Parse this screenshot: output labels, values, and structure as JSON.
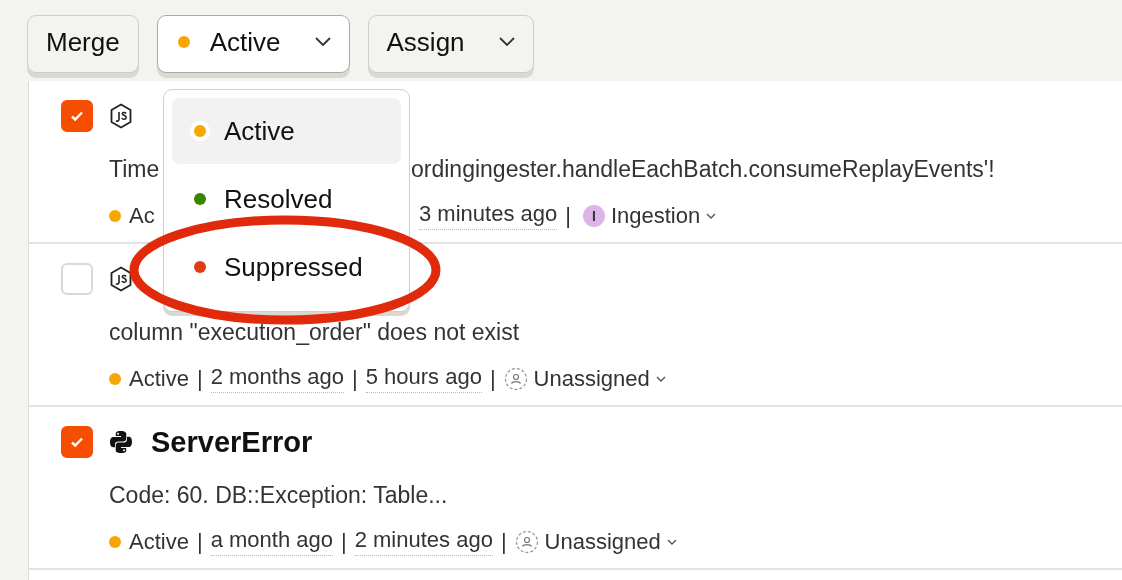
{
  "toolbar": {
    "buttons": [
      {
        "kind": "plain",
        "label": "Merge",
        "open": false
      },
      {
        "kind": "status",
        "label": "Active",
        "color": "#f7a501",
        "open": true
      },
      {
        "kind": "menu",
        "label": "Assign",
        "open": false
      }
    ]
  },
  "status_menu": {
    "options": [
      {
        "label": "Active",
        "color": "#f7a501",
        "selected": true,
        "circled": false
      },
      {
        "label": "Resolved",
        "color": "#388600",
        "selected": false,
        "circled": false
      },
      {
        "label": "Suppressed",
        "color": "#e03c16",
        "selected": false,
        "circled": true
      }
    ]
  },
  "issues": [
    {
      "checked": true,
      "kind": "js",
      "description": [
        "Time"
      ],
      "description_resumed": [
        "ordingingester.handleEachBatch.consumeReplayEvents'!"
      ],
      "meta": [
        {
          "kind": "status",
          "text": "Ac",
          "color": "#f7a501"
        }
      ],
      "meta_resumed": [
        {
          "kind": "time",
          "text": "3 minutes ago"
        },
        {
          "kind": "sep",
          "text": "|"
        },
        {
          "kind": "assignee",
          "text": "Ingestion",
          "avatar": "I"
        }
      ]
    },
    {
      "checked": false,
      "kind": "js",
      "description": [
        "column \"execution_order\" does not exist"
      ],
      "meta": [
        {
          "kind": "status",
          "text": "Active",
          "color": "#f7a501"
        },
        {
          "kind": "sep",
          "text": "|"
        },
        {
          "kind": "time",
          "text": "2 months ago"
        },
        {
          "kind": "sep",
          "text": "|"
        },
        {
          "kind": "time",
          "text": "5 hours ago"
        },
        {
          "kind": "sep",
          "text": "|"
        },
        {
          "kind": "unassigned",
          "text": "Unassigned"
        }
      ]
    },
    {
      "checked": true,
      "kind": "python",
      "title": "ServerError",
      "description": [
        "Code: 60. DB::Exception: Table..."
      ],
      "meta": [
        {
          "kind": "status",
          "text": "Active",
          "color": "#f7a501"
        },
        {
          "kind": "sep",
          "text": "|"
        },
        {
          "kind": "time",
          "text": "a month ago"
        },
        {
          "kind": "sep",
          "text": "|"
        },
        {
          "kind": "time",
          "text": "2 minutes ago"
        },
        {
          "kind": "sep",
          "text": "|"
        },
        {
          "kind": "unassigned",
          "text": "Unassigned"
        }
      ]
    }
  ]
}
